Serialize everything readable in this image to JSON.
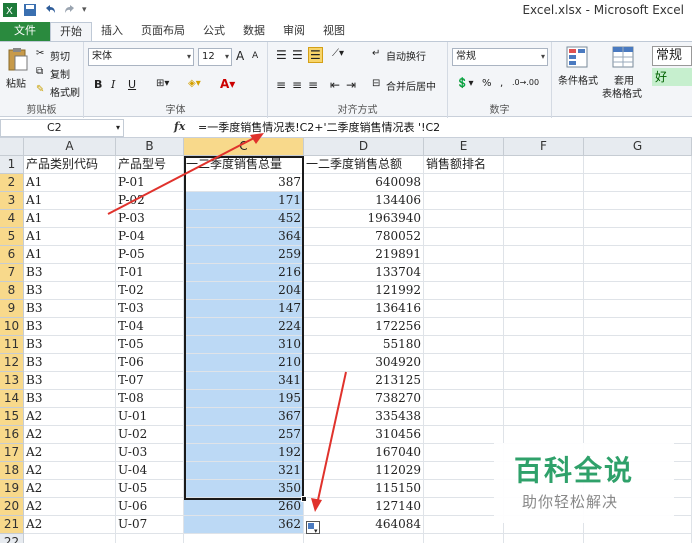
{
  "window": {
    "title": "Excel.xlsx - Microsoft Excel"
  },
  "tabs": [
    "文件",
    "开始",
    "插入",
    "页面布局",
    "公式",
    "数据",
    "审阅",
    "视图"
  ],
  "ribbon": {
    "clipboard": {
      "paste": "粘贴",
      "cut": "剪切",
      "copy": "复制",
      "format_painter": "格式刷",
      "label": "剪贴板"
    },
    "font": {
      "name": "宋体",
      "size": "12",
      "bold": "B",
      "italic": "I",
      "underline": "U",
      "grow": "A",
      "shrink": "A",
      "label": "字体"
    },
    "alignment": {
      "wrap": "自动换行",
      "merge": "合并后居中",
      "label": "对齐方式"
    },
    "number": {
      "format": "常规",
      "percent": "%",
      "comma": ",",
      "label": "数字"
    },
    "styles": {
      "conditional": "条件格式",
      "table_format_line1": "套用",
      "table_format_line2": "表格格式",
      "normal": "常规",
      "good": "好"
    }
  },
  "formula_bar": {
    "name_box": "C2",
    "fx": "fx",
    "formula": "=一季度销售情况表!C2+'二季度销售情况表 '!C2"
  },
  "columns": [
    "A",
    "B",
    "C",
    "D",
    "E",
    "F",
    "G"
  ],
  "headers": [
    "产品类别代码",
    "产品型号",
    "一二季度销售总量",
    "一二季度销售总额",
    "销售额排名"
  ],
  "rows": [
    [
      "A1",
      "P-01",
      "387",
      "640098"
    ],
    [
      "A1",
      "P-02",
      "171",
      "134406"
    ],
    [
      "A1",
      "P-03",
      "452",
      "1963940"
    ],
    [
      "A1",
      "P-04",
      "364",
      "780052"
    ],
    [
      "A1",
      "P-05",
      "259",
      "219891"
    ],
    [
      "B3",
      "T-01",
      "216",
      "133704"
    ],
    [
      "B3",
      "T-02",
      "204",
      "121992"
    ],
    [
      "B3",
      "T-03",
      "147",
      "136416"
    ],
    [
      "B3",
      "T-04",
      "224",
      "172256"
    ],
    [
      "B3",
      "T-05",
      "310",
      "55180"
    ],
    [
      "B3",
      "T-06",
      "210",
      "304920"
    ],
    [
      "B3",
      "T-07",
      "341",
      "213125"
    ],
    [
      "B3",
      "T-08",
      "195",
      "738270"
    ],
    [
      "A2",
      "U-01",
      "367",
      "335438"
    ],
    [
      "A2",
      "U-02",
      "257",
      "310456"
    ],
    [
      "A2",
      "U-03",
      "192",
      "167040"
    ],
    [
      "A2",
      "U-04",
      "321",
      "112029"
    ],
    [
      "A2",
      "U-05",
      "350",
      "115150"
    ],
    [
      "A2",
      "U-06",
      "260",
      "127140"
    ],
    [
      "A2",
      "U-07",
      "362",
      "464084"
    ]
  ],
  "row_numbers": [
    "1",
    "2",
    "3",
    "4",
    "5",
    "6",
    "7",
    "8",
    "9",
    "10",
    "11",
    "12",
    "13",
    "14",
    "15",
    "16",
    "17",
    "18",
    "19",
    "20",
    "21",
    "22"
  ],
  "watermark": {
    "big": "百科全说",
    "small": "助你轻松解决"
  },
  "colors": {
    "file_tab": "#2a8a3e",
    "selection": "#bcd9f5",
    "header_selected": "#f8d98b",
    "arrow": "#e0322c"
  }
}
